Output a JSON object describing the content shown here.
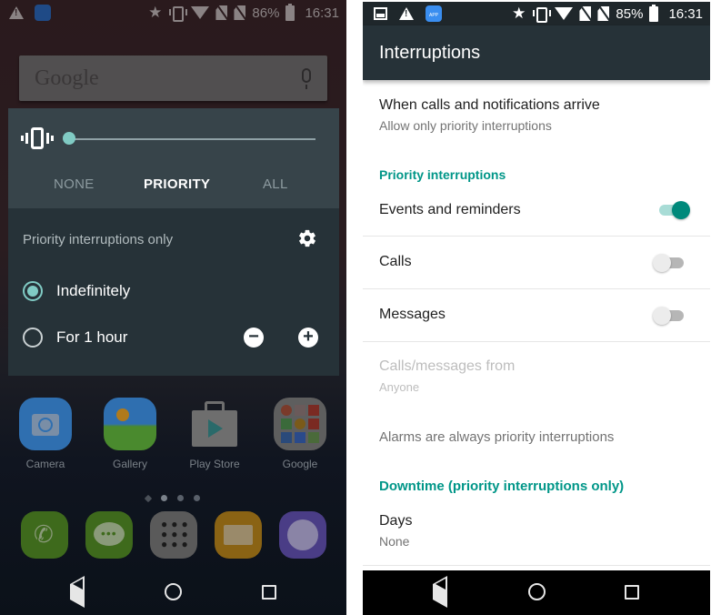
{
  "left_screen": {
    "status_bar": {
      "notification_icons": [
        "warning-icon",
        "app-icon"
      ],
      "system_icons": [
        "star-icon",
        "vibrate-icon",
        "wifi-icon",
        "no-sim-icon",
        "no-sim-icon"
      ],
      "battery": "86%",
      "time": "16:31"
    },
    "search_widget": {
      "logo": "Google",
      "mic_icon": "mic-icon"
    },
    "volume_panel": {
      "slider_value": 0,
      "modes": [
        "NONE",
        "PRIORITY",
        "ALL"
      ],
      "selected_mode": "PRIORITY"
    },
    "interruptions_panel": {
      "title": "Priority interruptions only",
      "options": [
        {
          "label": "Indefinitely",
          "selected": true
        },
        {
          "label": "For 1 hour",
          "selected": false
        }
      ],
      "decrease_label": "−",
      "increase_label": "+"
    },
    "apps": [
      {
        "label": "Camera",
        "color": "#2f6fb0"
      },
      {
        "label": "Gallery",
        "color": "#3e8a3a"
      },
      {
        "label": "Play Store",
        "color": "#6e6e6e"
      },
      {
        "label": "Google",
        "color": "#5e5e5e"
      }
    ],
    "page_indicator": {
      "pages": 4,
      "current": 1
    },
    "dock": [
      {
        "name": "phone",
        "color": "#3e6a1c"
      },
      {
        "name": "messages",
        "color": "#3e6a1c"
      },
      {
        "name": "app-drawer",
        "color": "#5a5a5a"
      },
      {
        "name": "email",
        "color": "#8a6314"
      },
      {
        "name": "browser",
        "color": "#4a3d86"
      }
    ]
  },
  "right_screen": {
    "status_bar": {
      "notification_icons": [
        "image-icon",
        "warning-icon",
        "app-icon"
      ],
      "app_icon_text": "APP",
      "system_icons": [
        "star-icon",
        "vibrate-icon",
        "wifi-icon",
        "no-sim-icon",
        "no-sim-icon"
      ],
      "battery": "85%",
      "time": "16:31"
    },
    "app_bar": {
      "title": "Interruptions"
    },
    "settings": {
      "when_calls": {
        "title": "When calls and notifications arrive",
        "summary": "Allow only priority interruptions"
      },
      "priority_category": "Priority interruptions",
      "events": {
        "title": "Events and reminders",
        "enabled": true
      },
      "calls": {
        "title": "Calls",
        "enabled": false
      },
      "messages": {
        "title": "Messages",
        "enabled": false
      },
      "calls_from": {
        "title": "Calls/messages from",
        "summary": "Anyone",
        "disabled": true
      },
      "alarms_note": "Alarms are always priority interruptions",
      "downtime_category": "Downtime (priority interruptions only)",
      "days": {
        "title": "Days",
        "summary": "None"
      }
    }
  },
  "colors": {
    "accent": "#009688",
    "accent_light": "#80cbc4",
    "panel_dark": "#263238",
    "panel_mid": "#37444a"
  }
}
